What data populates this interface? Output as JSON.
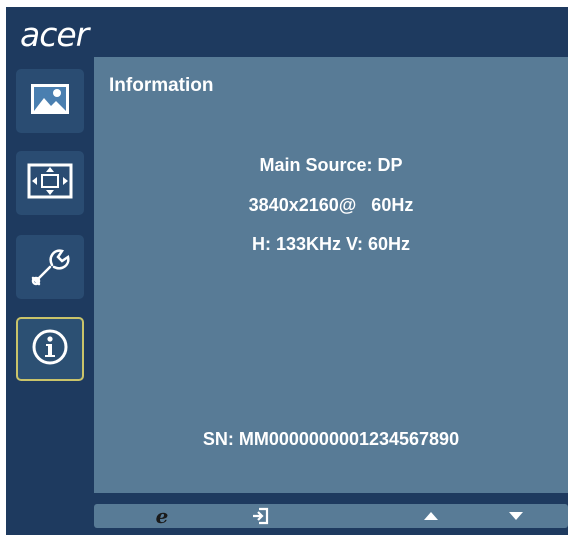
{
  "brand": "acer",
  "sidebar": {
    "items": [
      {
        "icon": "picture-icon"
      },
      {
        "icon": "position-icon"
      },
      {
        "icon": "settings-wrench-icon"
      },
      {
        "icon": "info-icon",
        "active": true
      }
    ]
  },
  "panel": {
    "title": "Information",
    "main_source": "Main Source: DP",
    "resolution": "3840x2160@   60Hz",
    "frequency": "H: 133KHz  V: 60Hz",
    "serial": "SN: MM0000000001234567890"
  },
  "footer": {
    "icons": [
      "e-key-icon",
      "exit-icon",
      "arrow-up-icon",
      "arrow-down-icon"
    ]
  },
  "colors": {
    "frame": "#1e3a5f",
    "panel": "#587b96",
    "active_border": "#c9c36a"
  }
}
